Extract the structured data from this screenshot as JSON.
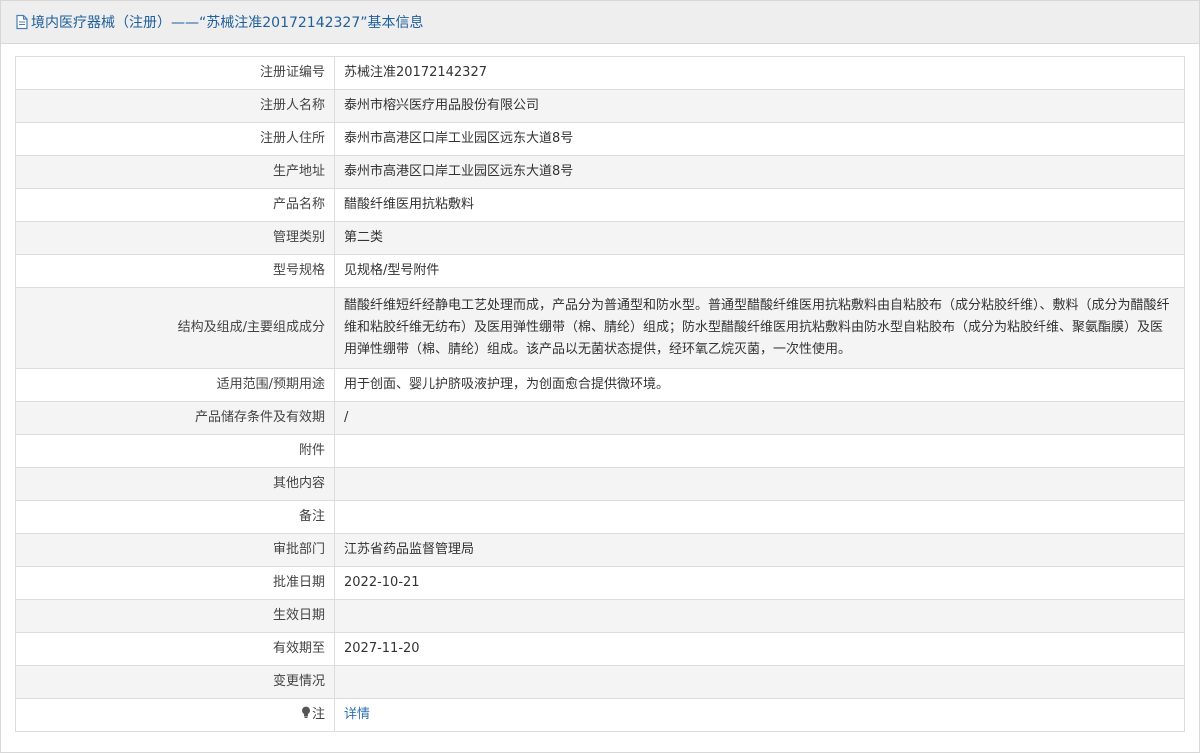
{
  "header": {
    "title": "境内医疗器械（注册）——“苏械注准20172142327”基本信息",
    "icon": "document-icon"
  },
  "rows": [
    {
      "label": "注册证编号",
      "value": "苏械注准20172142327"
    },
    {
      "label": "注册人名称",
      "value": "泰州市榕兴医疗用品股份有限公司"
    },
    {
      "label": "注册人住所",
      "value": "泰州市高港区口岸工业园区远东大道8号"
    },
    {
      "label": "生产地址",
      "value": "泰州市高港区口岸工业园区远东大道8号"
    },
    {
      "label": "产品名称",
      "value": "醋酸纤维医用抗粘敷料"
    },
    {
      "label": "管理类别",
      "value": "第二类"
    },
    {
      "label": "型号规格",
      "value": "见规格/型号附件"
    },
    {
      "label": "结构及组成/主要组成成分",
      "value": "醋酸纤维短纤经静电工艺处理而成，产品分为普通型和防水型。普通型醋酸纤维医用抗粘敷料由自粘胶布（成分粘胶纤维）、敷料（成分为醋酸纤维和粘胶纤维无纺布）及医用弹性绷带（棉、腈纶）组成；防水型醋酸纤维医用抗粘敷料由防水型自粘胶布（成分为粘胶纤维、聚氨酯膜）及医用弹性绷带（棉、腈纶）组成。该产品以无菌状态提供，经环氧乙烷灭菌，一次性使用。"
    },
    {
      "label": "适用范围/预期用途",
      "value": "用于创面、婴儿护脐吸液护理，为创面愈合提供微环境。"
    },
    {
      "label": "产品储存条件及有效期",
      "value": "/"
    },
    {
      "label": "附件",
      "value": ""
    },
    {
      "label": "其他内容",
      "value": ""
    },
    {
      "label": "备注",
      "value": ""
    },
    {
      "label": "审批部门",
      "value": "江苏省药品监督管理局"
    },
    {
      "label": "批准日期",
      "value": "2022-10-21"
    },
    {
      "label": "生效日期",
      "value": ""
    },
    {
      "label": "有效期至",
      "value": "2027-11-20"
    },
    {
      "label": "变更情况",
      "value": ""
    }
  ],
  "note_row": {
    "label": "注",
    "icon": "lightbulb-icon",
    "link_text": "详情"
  },
  "colors": {
    "title_text": "#1f5f9c",
    "link": "#2c6fb0",
    "row_alt": "#f4f4f4",
    "border": "#dcdcdc"
  }
}
